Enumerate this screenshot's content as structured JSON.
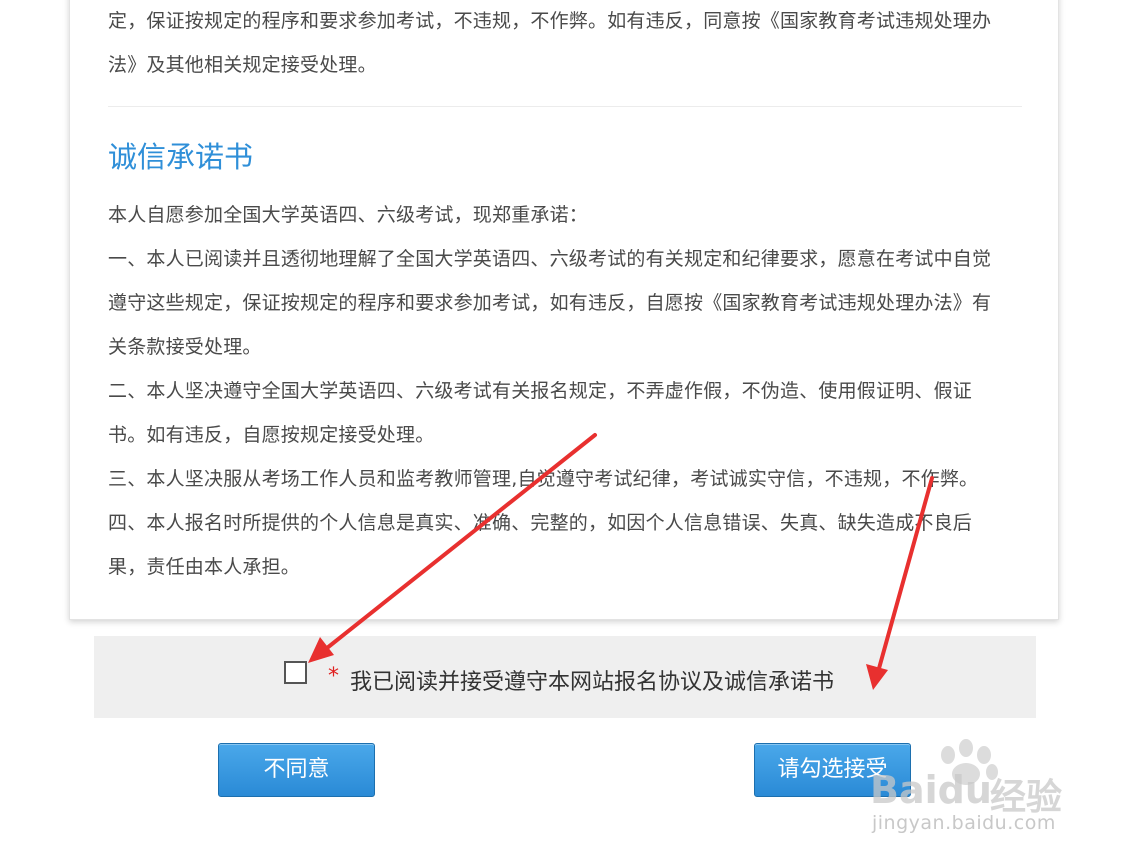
{
  "registration_agreement": {
    "lines": [
      "定，保证按规定的程序和要求参加考试，不违规，不作弊。如有违反，同意按《国家教育考试违规处理办",
      "法》及其他相关规定接受处理。"
    ]
  },
  "integrity_pledge": {
    "title": "诚信承诺书",
    "lines": [
      "本人自愿参加全国大学英语四、六级考试，现郑重承诺：",
      "一、本人已阅读并且透彻地理解了全国大学英语四、六级考试的有关规定和纪律要求，愿意在考试中自觉",
      "遵守这些规定，保证按规定的程序和要求参加考试，如有违反，自愿按《国家教育考试违规处理办法》有",
      "关条款接受处理。",
      "二、本人坚决遵守全国大学英语四、六级考试有关报名规定，不弄虚作假，不伪造、使用假证明、假证",
      "书。如有违反，自愿按规定接受处理。",
      "三、本人坚决服从考场工作人员和监考教师管理,自觉遵守考试纪律，考试诚实守信，不违规，不作弊。",
      "四、本人报名时所提供的个人信息是真实、准确、完整的，如因个人信息错误、失真、缺失造成不良后",
      "果，责任由本人承担。"
    ]
  },
  "agreement": {
    "required_mark": "*",
    "label": "我已阅读并接受遵守本网站报名协议及诚信承诺书",
    "checked": false
  },
  "buttons": {
    "disagree": "不同意",
    "accept": "请勾选接受"
  },
  "watermark": {
    "brand": "Baidu",
    "brand_cn": "经验",
    "url": "jingyan.baidu.com"
  },
  "colors": {
    "title_blue": "#2f8fd8",
    "button_blue": "#2a8ad6",
    "annotation_red": "#e8302f",
    "required_red": "#e02020"
  }
}
